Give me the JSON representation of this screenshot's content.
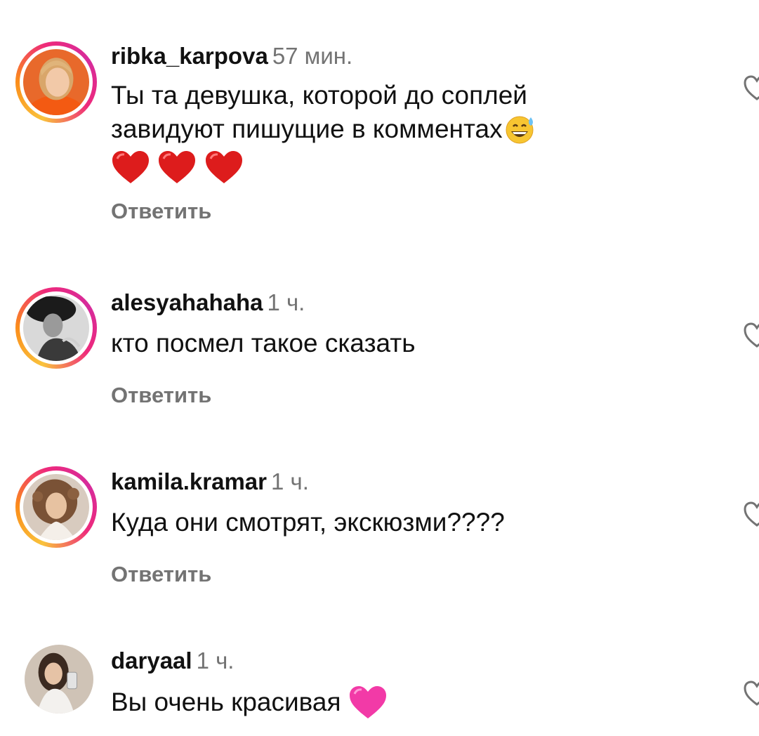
{
  "comments": [
    {
      "username": "ribka_karpova",
      "time": "57 мин.",
      "text_line1": "Ты та девушка, которой до соплей",
      "text_line2": "завидуют пишущие в комментах",
      "reply_label": "Ответить",
      "has_story_ring": true,
      "emojis": [
        "sweat-smile-emoji",
        "red-heart-emoji",
        "red-heart-emoji",
        "red-heart-emoji"
      ]
    },
    {
      "username": "alesyahahaha",
      "time": "1 ч.",
      "text": "кто посмел такое сказать",
      "reply_label": "Ответить",
      "has_story_ring": true
    },
    {
      "username": "kamila.kramar",
      "time": "1 ч.",
      "text": "Куда они смотрят, экскюзми????",
      "reply_label": "Ответить",
      "has_story_ring": true
    },
    {
      "username": "daryaal",
      "time": "1 ч.",
      "text": "Вы очень красивая",
      "has_story_ring": false,
      "emojis": [
        "pink-heart-emoji"
      ]
    }
  ],
  "colors": {
    "secondary_text": "#737373",
    "ring_gradient": [
      "#f9c23c",
      "#fb8c1a",
      "#ee2a7b",
      "#d62b9c"
    ]
  }
}
